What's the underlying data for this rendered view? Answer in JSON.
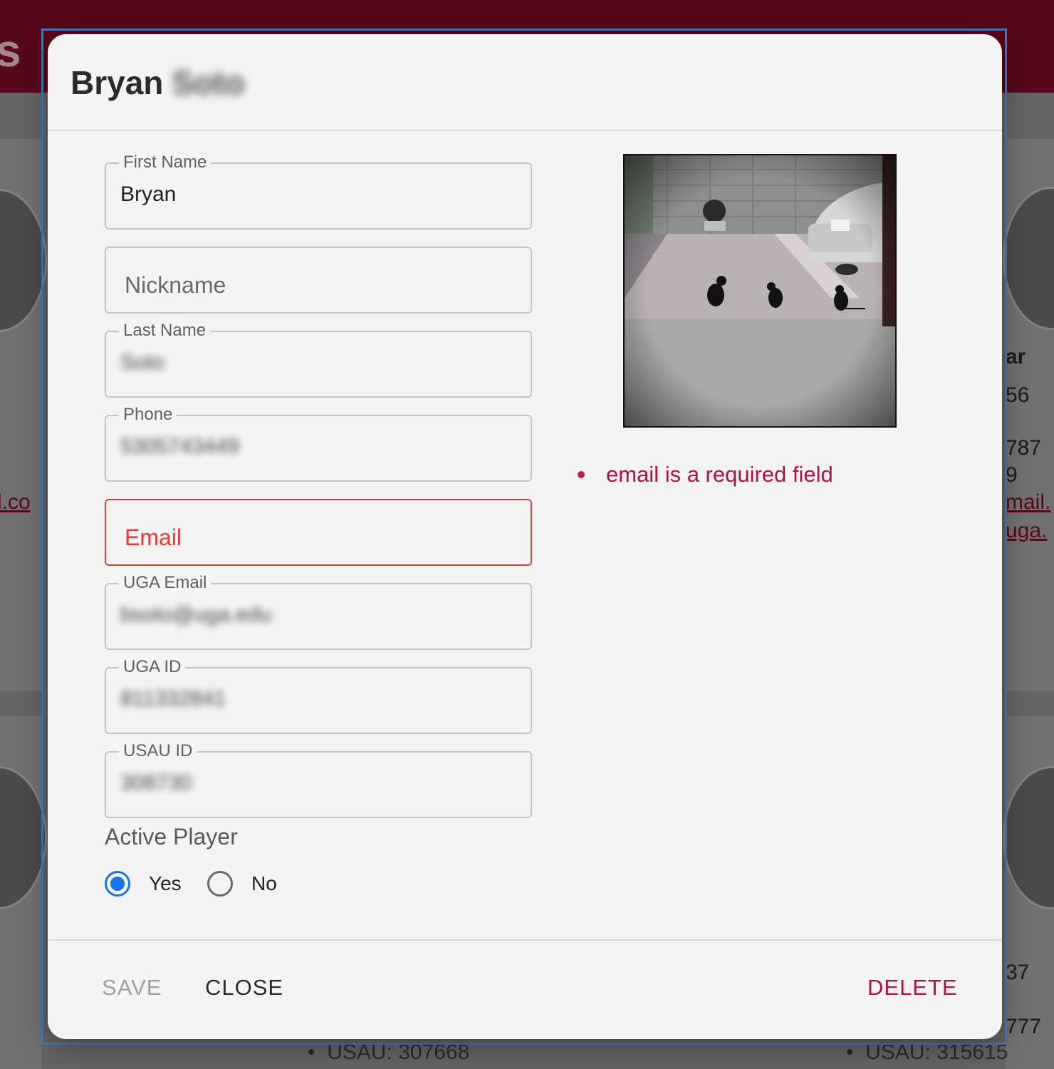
{
  "background": {
    "header_letter": "s",
    "left_link": "l.co",
    "right_texts": [
      "ar",
      "56",
      "787",
      "9",
      "mail.",
      "uga."
    ],
    "right_lower_texts": [
      "37",
      "777"
    ],
    "bottom_left": "USAU: 307668",
    "bottom_right": "USAU: 315615"
  },
  "dialog": {
    "title_first": "Bryan",
    "title_last": "Soto"
  },
  "fields": {
    "first_name": {
      "label": "First Name",
      "value": "Bryan"
    },
    "nickname": {
      "placeholder": "Nickname"
    },
    "last_name": {
      "label": "Last Name",
      "value": "Soto"
    },
    "phone": {
      "label": "Phone",
      "value": "5305743449"
    },
    "email": {
      "placeholder": "Email"
    },
    "uga_email": {
      "label": "UGA Email",
      "value": "bsoto@uga.edu"
    },
    "uga_id": {
      "label": "UGA ID",
      "value": "811332841"
    },
    "usau_id": {
      "label": "USAU ID",
      "value": "308730"
    }
  },
  "active_player": {
    "title": "Active Player",
    "options": [
      {
        "label": "Yes",
        "checked": true
      },
      {
        "label": "No",
        "checked": false
      }
    ]
  },
  "errors": [
    "email is a required field"
  ],
  "actions": {
    "save": "SAVE",
    "close": "CLOSE",
    "delete": "DELETE"
  },
  "colors": {
    "accent": "#1a73e8",
    "error": "#e53935",
    "brand": "#6b0a1f",
    "delete": "#b0123b"
  }
}
